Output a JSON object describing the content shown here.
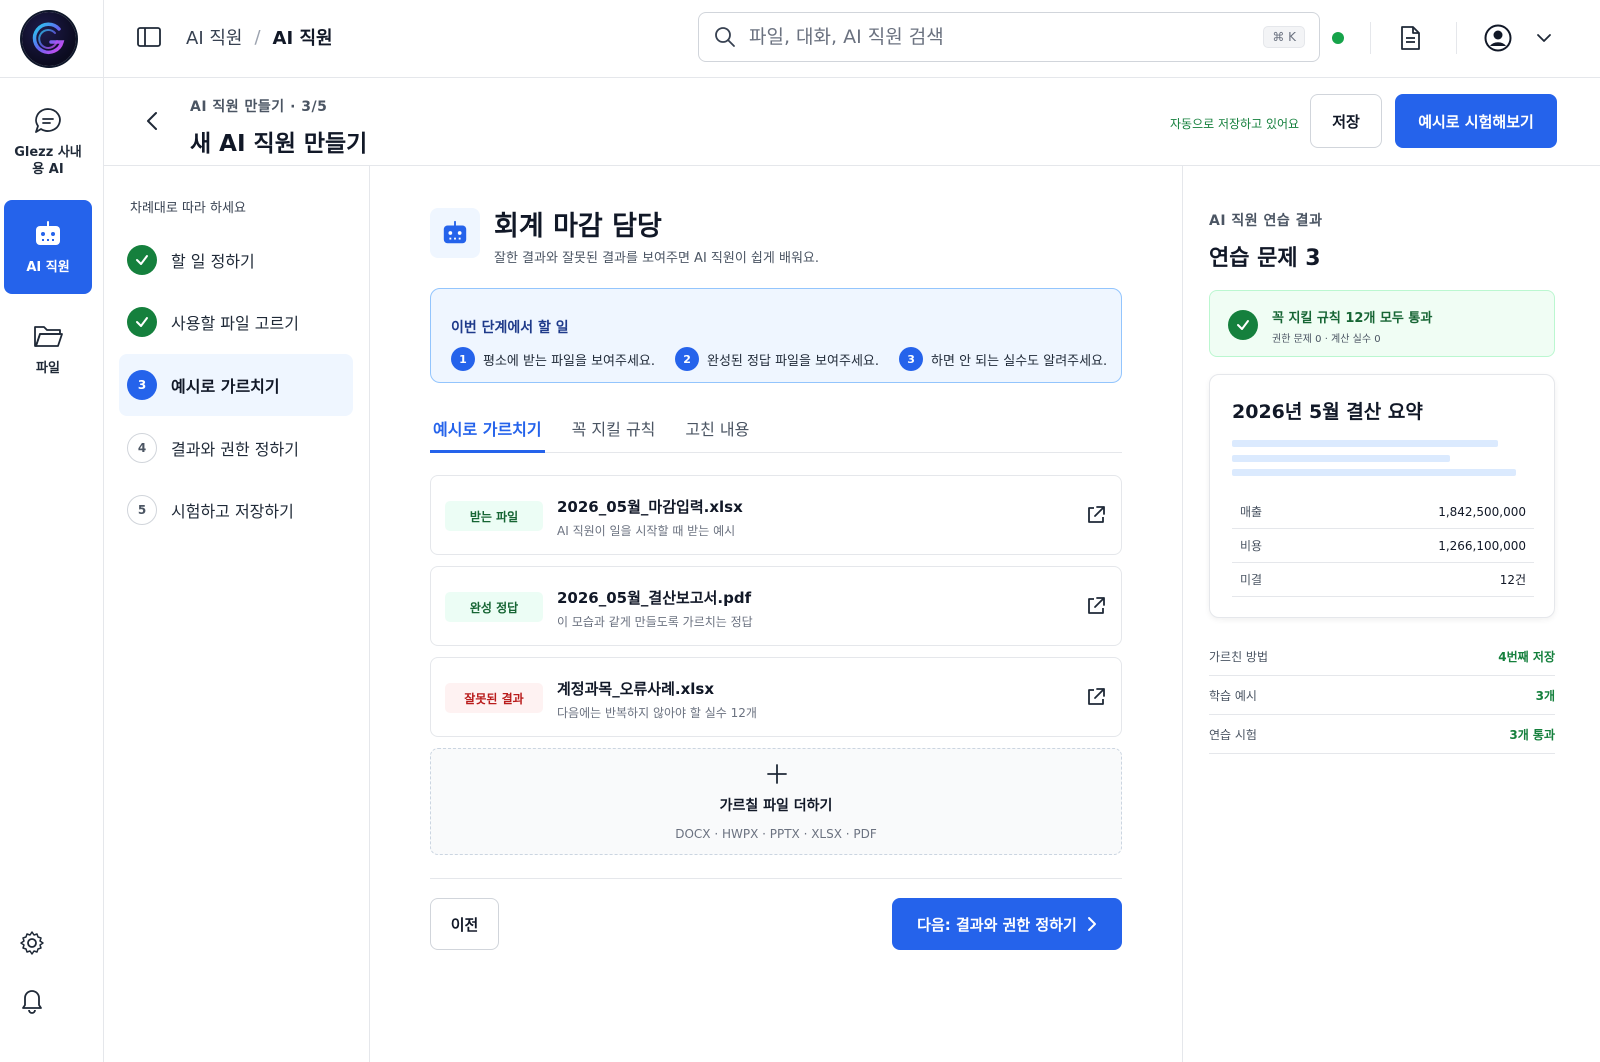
{
  "app": {
    "name": "Glezz 사내용 AI",
    "accent": "#2563eb",
    "success": "#15803d"
  },
  "rail": {
    "logo_icon": "glezz-logo",
    "items": [
      {
        "label": "Glezz 사내용 AI",
        "icon": "chat-icon",
        "active": false
      },
      {
        "label": "AI 직원",
        "icon": "robot-icon",
        "active": true
      },
      {
        "label": "파일",
        "icon": "folder-icon",
        "active": false
      }
    ],
    "bottom_icons": [
      "gear-icon",
      "bell-icon"
    ]
  },
  "topbar": {
    "breadcrumb": [
      "AI 직원",
      "AI 직원"
    ],
    "breadcrumb_sep": "/",
    "search_placeholder": "파일, 대화, AI 직원 검색",
    "search_shortcut": "⌘ K"
  },
  "header": {
    "step_label": "AI 직원 만들기 · 3/5",
    "title": "새 AI 직원 만들기",
    "autosave": "자동으로 저장하고 있어요",
    "save_label": "저장",
    "try_label": "예시로 시험해보기"
  },
  "steps": {
    "hint": "차례대로 따라 하세요",
    "items": [
      {
        "num": "1",
        "label": "할 일 정하기",
        "state": "done"
      },
      {
        "num": "2",
        "label": "사용할 파일 고르기",
        "state": "done"
      },
      {
        "num": "3",
        "label": "예시로 가르치기",
        "state": "current"
      },
      {
        "num": "4",
        "label": "결과와 권한 정하기",
        "state": "todo"
      },
      {
        "num": "5",
        "label": "시험하고 저장하기",
        "state": "todo"
      }
    ]
  },
  "main": {
    "agent_name": "회계 마감 담당",
    "agent_desc": "잘한 결과와 잘못된 결과를 보여주면 AI 직원이 쉽게 배워요.",
    "todo": {
      "title": "이번 단계에서 할 일",
      "items": [
        {
          "num": "1",
          "text": "평소에 받는 파일을 보여주세요."
        },
        {
          "num": "2",
          "text": "완성된 정답 파일을 보여주세요."
        },
        {
          "num": "3",
          "text": "하면 안 되는 실수도 알려주세요."
        }
      ]
    },
    "tabs": [
      {
        "label": "예시로 가르치기",
        "active": true
      },
      {
        "label": "꼭 지킬 규칙",
        "active": false
      },
      {
        "label": "고친 내용",
        "active": false
      }
    ],
    "files": [
      {
        "tag": "받는 파일",
        "tag_color": "green",
        "name": "2026_05월_마감입력.xlsx",
        "desc": "AI 직원이 일을 시작할 때 받는 예시"
      },
      {
        "tag": "완성 정답",
        "tag_color": "green",
        "name": "2026_05월_결산보고서.pdf",
        "desc": "이 모습과 같게 만들도록 가르치는 정답"
      },
      {
        "tag": "잘못된 결과",
        "tag_color": "red",
        "name": "계정과목_오류사례.xlsx",
        "desc": "다음에는 반복하지 않아야 할 실수 12개"
      }
    ],
    "drop": {
      "title": "가르칠 파일 더하기",
      "types": "DOCX · HWPX · PPTX · XLSX · PDF"
    },
    "prev_label": "이전",
    "next_label": "다음: 결과와 권한 정하기"
  },
  "right": {
    "label": "AI 직원 연습 결과",
    "title": "연습 문제 3",
    "pass": {
      "title": "꼭 지킬 규칙 12개 모두 통과",
      "sub": "권한 문제 0 · 계산 실수 0"
    },
    "doc": {
      "title": "2026년 5월 결산 요약",
      "rows": [
        {
          "k": "매출",
          "v": "1,842,500,000"
        },
        {
          "k": "비용",
          "v": "1,266,100,000"
        },
        {
          "k": "미결",
          "v": "12건"
        }
      ]
    },
    "stats": [
      {
        "k": "가르친 방법",
        "v": "4번째 저장"
      },
      {
        "k": "학습 예시",
        "v": "3개"
      },
      {
        "k": "연습 시험",
        "v": "3개 통과"
      }
    ]
  }
}
